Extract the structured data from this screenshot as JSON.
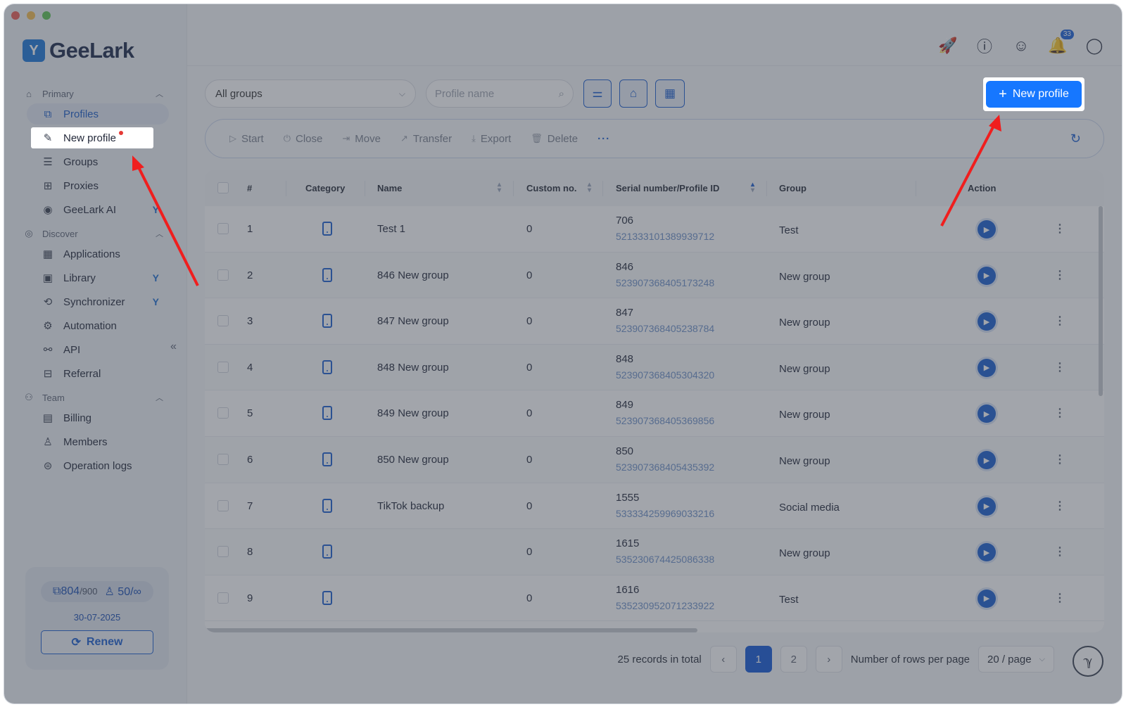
{
  "window": {
    "traffic_colors": [
      "#ec5f56",
      "#f4bd4f",
      "#5fc454"
    ]
  },
  "brand": {
    "name": "GeeLark",
    "mark_glyph": "Y"
  },
  "sidebar": {
    "sections": [
      {
        "label": "Primary",
        "icon": "home-icon"
      },
      {
        "label": "Discover",
        "icon": "eye-icon"
      },
      {
        "label": "Team",
        "icon": "users-icon"
      }
    ],
    "primary_items": [
      {
        "label": "Profiles",
        "icon": "profiles-icon",
        "active": true
      },
      {
        "label": "New profile",
        "icon": "edit-icon",
        "highlight": true
      },
      {
        "label": "Groups",
        "icon": "list-icon"
      },
      {
        "label": "Proxies",
        "icon": "proxy-icon"
      },
      {
        "label": "GeeLark AI",
        "icon": "ai-icon"
      }
    ],
    "discover_items": [
      {
        "label": "Applications",
        "icon": "grid-icon"
      },
      {
        "label": "Library",
        "icon": "library-icon"
      },
      {
        "label": "Synchronizer",
        "icon": "sync-icon"
      },
      {
        "label": "Automation",
        "icon": "robot-icon"
      },
      {
        "label": "API",
        "icon": "api-icon"
      },
      {
        "label": "Referral",
        "icon": "gift-icon"
      }
    ],
    "team_items": [
      {
        "label": "Billing",
        "icon": "billing-icon"
      },
      {
        "label": "Members",
        "icon": "member-icon"
      },
      {
        "label": "Operation logs",
        "icon": "logs-icon"
      }
    ],
    "usage": {
      "profiles_used": "804",
      "profiles_total": "/900",
      "members_used": "50",
      "members_total": "/∞",
      "expiry": "30-07-2025",
      "renew_label": "Renew"
    }
  },
  "topbar": {
    "notification_count": "33",
    "icons": [
      "rocket-icon",
      "help-icon",
      "support-icon",
      "bell-icon",
      "account-icon"
    ]
  },
  "filters": {
    "group_select": "All groups",
    "search_placeholder": "Profile name",
    "new_profile_label": "New profile"
  },
  "actions": [
    "Start",
    "Close",
    "Move",
    "Transfer",
    "Export",
    "Delete"
  ],
  "table": {
    "headers": {
      "index": "#",
      "category": "Category",
      "name": "Name",
      "custom": "Custom no.",
      "serial": "Serial number/Profile ID",
      "group": "Group",
      "action": "Action"
    },
    "rows": [
      {
        "idx": "1",
        "name": "Test 1",
        "custom": "0",
        "serial": "706",
        "pid": "521333101389939712",
        "group": "Test"
      },
      {
        "idx": "2",
        "name": "846 New group",
        "custom": "0",
        "serial": "846",
        "pid": "523907368405173248",
        "group": "New group"
      },
      {
        "idx": "3",
        "name": "847 New group",
        "custom": "0",
        "serial": "847",
        "pid": "523907368405238784",
        "group": "New group"
      },
      {
        "idx": "4",
        "name": "848 New group",
        "custom": "0",
        "serial": "848",
        "pid": "523907368405304320",
        "group": "New group"
      },
      {
        "idx": "5",
        "name": "849 New group",
        "custom": "0",
        "serial": "849",
        "pid": "523907368405369856",
        "group": "New group"
      },
      {
        "idx": "6",
        "name": "850 New group",
        "custom": "0",
        "serial": "850",
        "pid": "523907368405435392",
        "group": "New group"
      },
      {
        "idx": "7",
        "name": "TikTok backup",
        "custom": "0",
        "serial": "1555",
        "pid": "533334259969033216",
        "group": "Social media"
      },
      {
        "idx": "8",
        "name": "",
        "custom": "0",
        "serial": "1615",
        "pid": "535230674425086338",
        "group": "New group"
      },
      {
        "idx": "9",
        "name": "",
        "custom": "0",
        "serial": "1616",
        "pid": "535230952071233922",
        "group": "Test"
      }
    ]
  },
  "pagination": {
    "total": "25 records in total",
    "pages": [
      "1",
      "2"
    ],
    "rows_label": "Number of rows per page",
    "rows_value": "20 / page"
  }
}
